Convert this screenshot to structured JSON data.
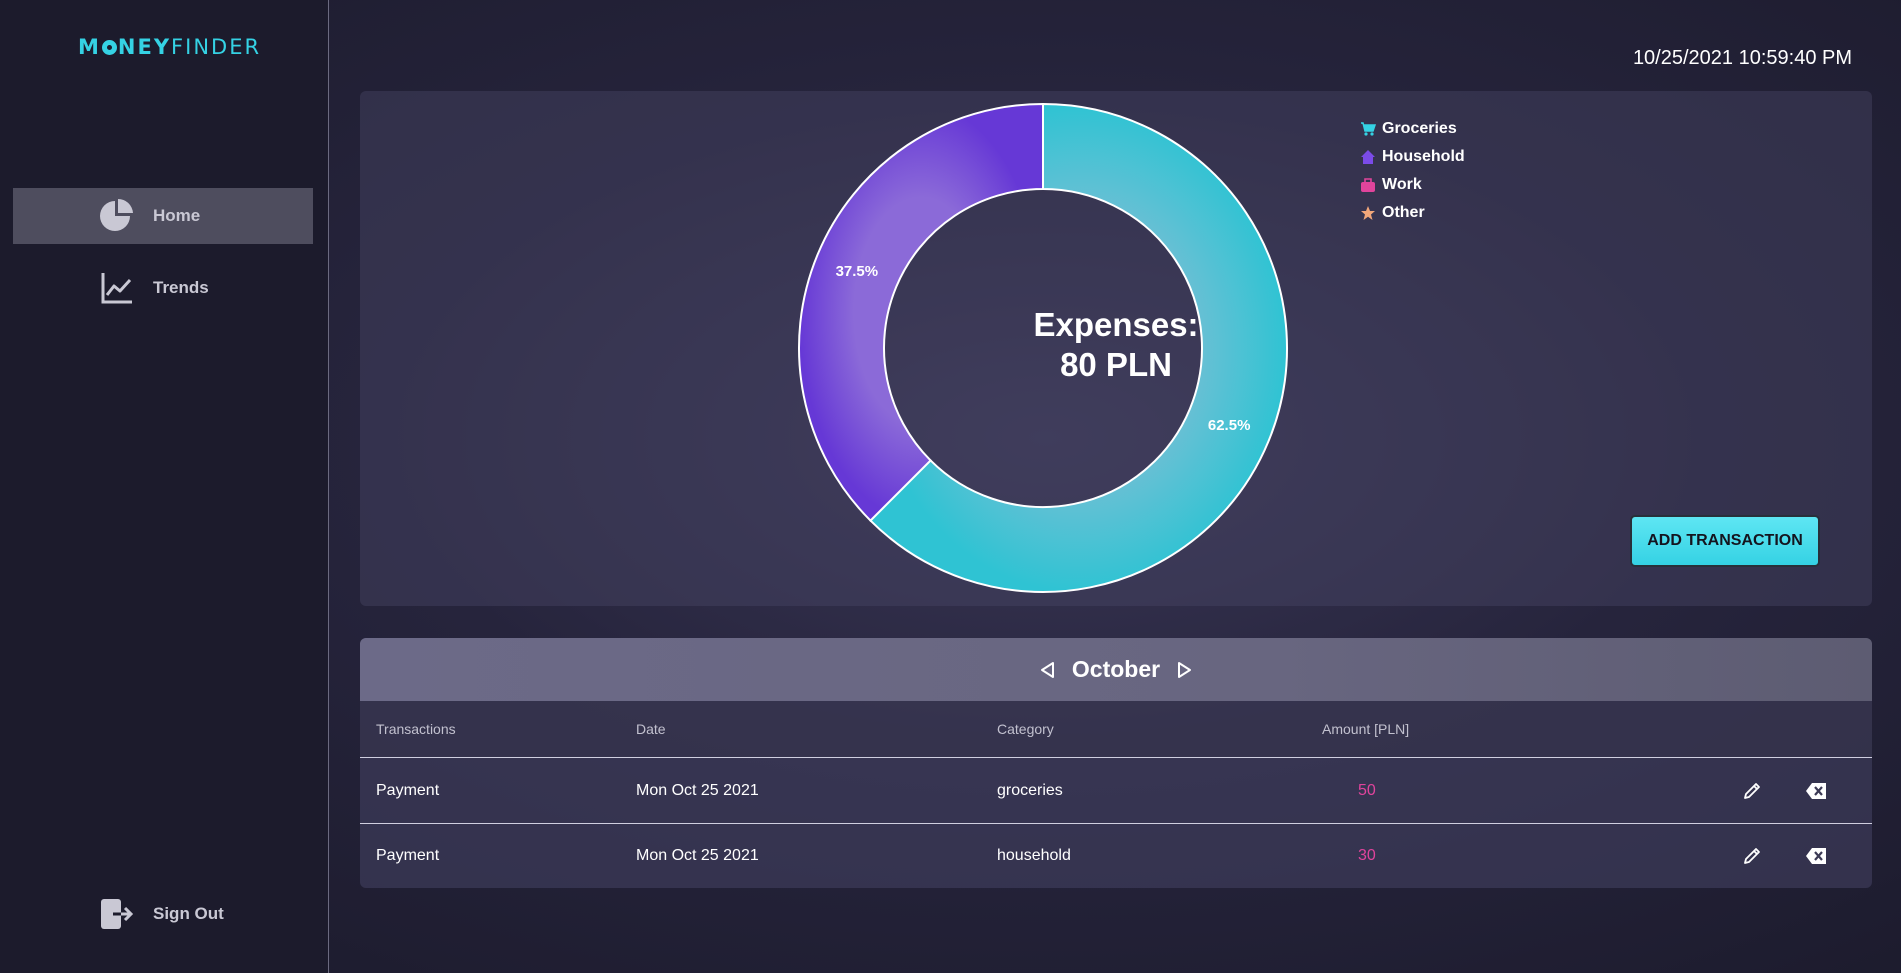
{
  "app": {
    "logo_part1": "M",
    "logo_part2": "NEY",
    "logo_part3": "FINDER"
  },
  "sidebar": {
    "items": [
      {
        "label": "Home",
        "icon": "pie-chart-icon",
        "active": true
      },
      {
        "label": "Trends",
        "icon": "line-chart-icon",
        "active": false
      }
    ],
    "signout_label": "Sign Out",
    "signout_icon": "sign-out-icon"
  },
  "header": {
    "datetime": "10/25/2021 10:59:40 PM"
  },
  "summary": {
    "center_line1": "Expenses:",
    "center_line2": "80 PLN",
    "add_button_label": "ADD TRANSACTION"
  },
  "chart_data": {
    "type": "pie",
    "categories": [
      "Groceries",
      "Household",
      "Work",
      "Other"
    ],
    "values": [
      62.5,
      37.5,
      0,
      0
    ],
    "data_labels": [
      "62.5%",
      "37.5%"
    ],
    "colors": [
      "#2fc3d3",
      "#6638d6",
      "#e0449c",
      "#f2a77a"
    ],
    "legend_position": "top-right",
    "legend": [
      {
        "label": "Groceries",
        "icon": "cart-icon",
        "color": "#35d2e4"
      },
      {
        "label": "Household",
        "icon": "house-icon",
        "color": "#7b4be8"
      },
      {
        "label": "Work",
        "icon": "briefcase-icon",
        "color": "#e0449c"
      },
      {
        "label": "Other",
        "icon": "star-icon",
        "color": "#f2a77a"
      }
    ]
  },
  "table": {
    "month": "October",
    "headers": [
      "Transactions",
      "Date",
      "Category",
      "Amount [PLN]"
    ],
    "rows": [
      {
        "transaction": "Payment",
        "date": "Mon Oct 25 2021",
        "category": "groceries",
        "amount": "50"
      },
      {
        "transaction": "Payment",
        "date": "Mon Oct 25 2021",
        "category": "household",
        "amount": "30"
      }
    ]
  }
}
